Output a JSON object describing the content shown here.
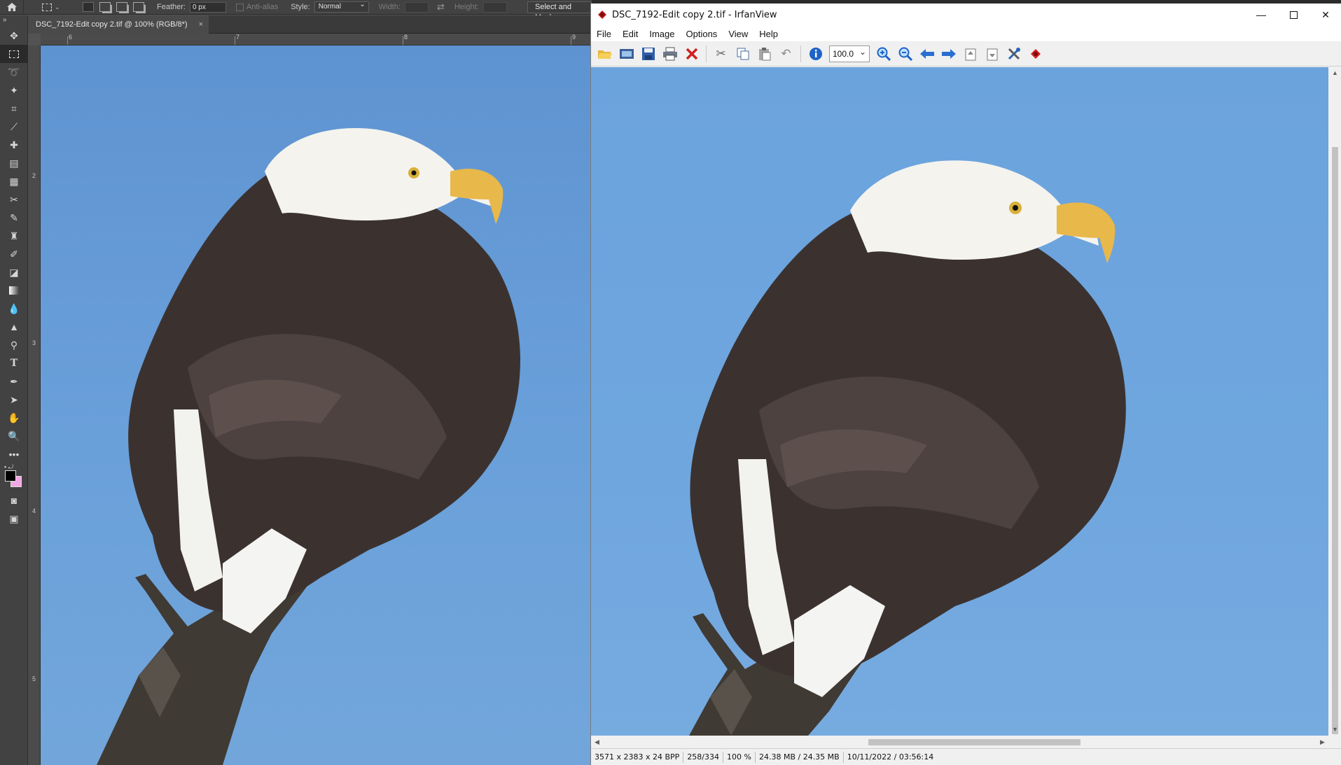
{
  "photoshop": {
    "options_bar": {
      "feather_label": "Feather:",
      "feather_value": "0 px",
      "anti_alias_label": "Anti-alias",
      "style_label": "Style:",
      "style_value": "Normal",
      "width_label": "Width:",
      "height_label": "Height:",
      "select_and_mask_label": "Select and Mask..."
    },
    "document_tab": {
      "title": "DSC_7192-Edit copy 2.tif @ 100% (RGB/8*)",
      "close": "×"
    },
    "ruler_top_numbers": [
      "6",
      "7",
      "8",
      "9"
    ],
    "ruler_left_numbers": [
      "2",
      "3",
      "4",
      "5"
    ],
    "tools": [
      "move-tool",
      "marquee-tool",
      "lasso-tool",
      "magic-wand-tool",
      "crop-tool",
      "eyedropper-tool",
      "spot-healing-tool",
      "patch-tool",
      "content-aware-move-tool",
      "red-eye-tool",
      "brush-tool",
      "clone-stamp-tool",
      "history-brush-tool",
      "eraser-tool",
      "gradient-tool",
      "blur-tool",
      "sharpen-tool",
      "dodge-tool",
      "type-tool",
      "pen-tool",
      "path-selection-tool",
      "hand-tool",
      "zoom-tool",
      "more-tools"
    ],
    "foreground_color": "#000000",
    "background_color": "#f2a6e6"
  },
  "irfanview": {
    "window_title": "DSC_7192-Edit copy 2.tif - IrfanView",
    "menu": [
      "File",
      "Edit",
      "Image",
      "Options",
      "View",
      "Help"
    ],
    "toolbar": {
      "zoom_value": "100.0",
      "buttons": [
        "open-icon",
        "slideshow-icon",
        "save-icon",
        "print-icon",
        "delete-icon",
        "cut-icon",
        "copy-icon",
        "paste-icon",
        "undo-icon",
        "info-icon",
        "zoom-in-icon",
        "zoom-out-icon",
        "previous-icon",
        "next-icon",
        "page-up-icon",
        "page-down-icon",
        "settings-icon",
        "exit-icon"
      ]
    },
    "status": {
      "dimensions": "3571 x 2383 x 24 BPP",
      "index": "258/334",
      "zoom": "100 %",
      "memory": "24.38 MB / 24.35 MB",
      "datetime": "10/11/2022 / 03:56:14"
    }
  }
}
